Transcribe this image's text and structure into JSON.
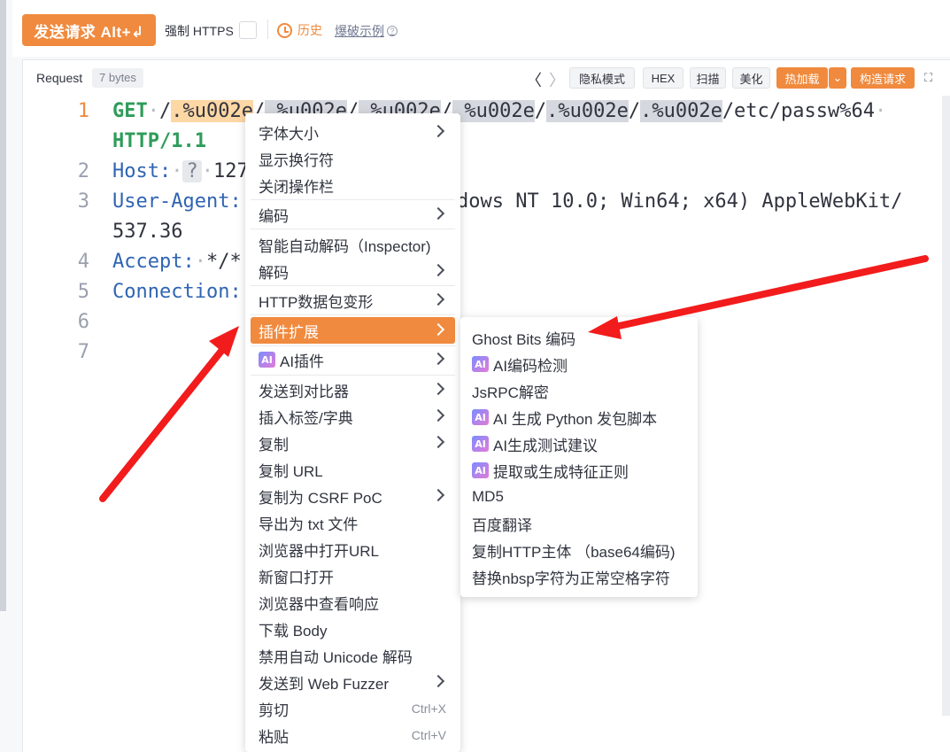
{
  "toolbar": {
    "send_label": "发送请求 Alt+↲",
    "https_label": "强制 HTTPS",
    "history_label": "历史",
    "example_label": "爆破示例",
    "help_glyph": "?"
  },
  "request": {
    "title": "Request",
    "bytes": "7 bytes",
    "prev": "〈",
    "next": "〉",
    "buttons": [
      "隐私模式",
      "HEX",
      "扫描",
      "美化",
      "热加载",
      "构造请求"
    ],
    "hotload_dropdown": "⌄",
    "expand_glyph": "⛶"
  },
  "editor": {
    "line_numbers": [
      "1",
      "2",
      "3",
      "4",
      "5",
      "6",
      "7"
    ],
    "line1_method": "GET",
    "line1_path_prefix": "/",
    "line1_seg1": ".%u002e",
    "line1_seg2": ".%u002e",
    "line1_seg3": ".%u002e",
    "line1_seg4": ".%u002e",
    "line1_seg5": ".%u002e",
    "line1_seg6": ".%u002e",
    "line1_tail": "/etc/passw%64",
    "line1_proto": "HTTP/1.1",
    "host_key": "Host:",
    "host_q": "?",
    "host_val": "127",
    "ua_key": "User-Agent:",
    "ua_val": "dows NT 10.0; Win64; x64) AppleWebKit/",
    "ua_cont": "537.36",
    "accept_key": "Accept:",
    "accept_val": "*/*",
    "conn_key": "Connection:"
  },
  "context_menu": {
    "items": [
      {
        "label": "字体大小",
        "sub": true
      },
      {
        "label": "显示换行符"
      },
      {
        "label": "关闭操作栏"
      },
      {
        "label": "编码",
        "sub": true
      },
      {
        "label": "智能自动解码（Inspector)"
      },
      {
        "label": "解码",
        "sub": true
      },
      {
        "label": "HTTP数据包变形",
        "sub": true
      },
      {
        "label": "插件扩展",
        "sub": true,
        "active": true
      },
      {
        "label": "AI插件",
        "sub": true,
        "ai": true
      },
      {
        "label": "发送到对比器",
        "sub": true
      },
      {
        "label": "插入标签/字典",
        "sub": true
      },
      {
        "label": "复制",
        "sub": true
      },
      {
        "label": "复制 URL"
      },
      {
        "label": "复制为 CSRF PoC",
        "sub": true
      },
      {
        "label": "导出为 txt 文件"
      },
      {
        "label": "浏览器中打开URL"
      },
      {
        "label": "新窗口打开"
      },
      {
        "label": "浏览器中查看响应"
      },
      {
        "label": "下载 Body"
      },
      {
        "label": "禁用自动 Unicode 解码"
      },
      {
        "label": "发送到 Web Fuzzer",
        "sub": true
      },
      {
        "label": "剪切",
        "shortcut": "Ctrl+X"
      },
      {
        "label": "粘贴",
        "shortcut": "Ctrl+V"
      }
    ],
    "ai_badge": "AI"
  },
  "submenu": {
    "items": [
      {
        "label": "Ghost Bits 编码"
      },
      {
        "label": "AI编码检测",
        "ai": true
      },
      {
        "label": "JsRPC解密"
      },
      {
        "label": "AI 生成 Python 发包脚本",
        "ai": true
      },
      {
        "label": "AI生成测试建议",
        "ai": true
      },
      {
        "label": "提取或生成特征正则",
        "ai": true
      },
      {
        "label": "MD5"
      },
      {
        "label": "百度翻译"
      },
      {
        "label": "复制HTTP主体 （base64编码)"
      },
      {
        "label": "替换nbsp字符为正常空格字符"
      }
    ]
  },
  "colors": {
    "accent": "#f08a3e",
    "arrow": "#f21c1c",
    "keyword_green": "#2f9c5a",
    "header_blue": "#2f64b3"
  }
}
